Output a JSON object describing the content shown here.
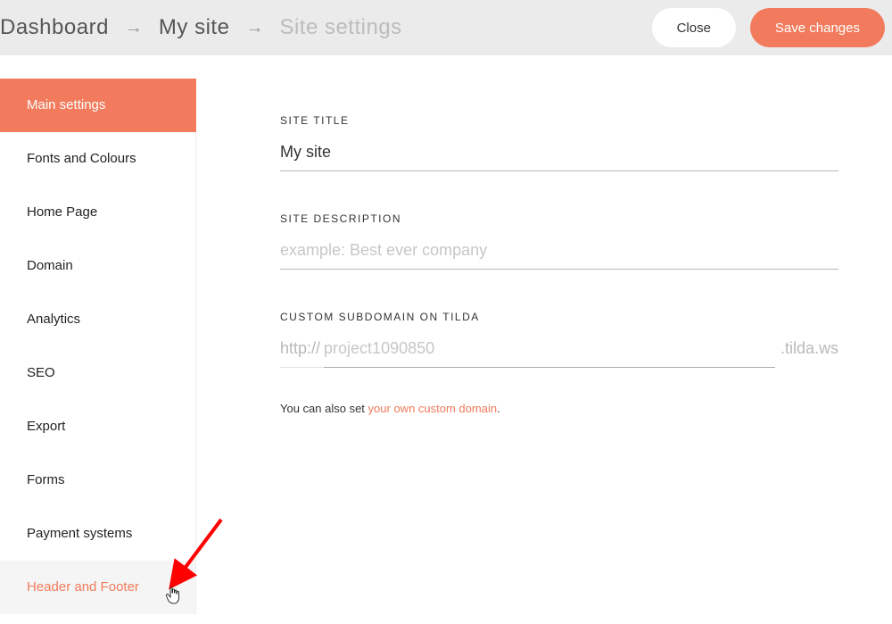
{
  "breadcrumb": {
    "dashboard": "Dashboard",
    "site_name": "My site",
    "current": "Site settings"
  },
  "buttons": {
    "close": "Close",
    "save": "Save changes"
  },
  "sidebar": {
    "items": [
      {
        "label": "Main settings",
        "state": "active"
      },
      {
        "label": "Fonts and Colours",
        "state": ""
      },
      {
        "label": "Home Page",
        "state": ""
      },
      {
        "label": "Domain",
        "state": ""
      },
      {
        "label": "Analytics",
        "state": ""
      },
      {
        "label": "SEO",
        "state": ""
      },
      {
        "label": "Export",
        "state": ""
      },
      {
        "label": "Forms",
        "state": ""
      },
      {
        "label": "Payment systems",
        "state": ""
      },
      {
        "label": "Header and Footer",
        "state": "hover"
      }
    ]
  },
  "form": {
    "site_title": {
      "label": "SITE TITLE",
      "value": "My site"
    },
    "site_description": {
      "label": "SITE DESCRIPTION",
      "value": "",
      "placeholder": "example: Best ever company"
    },
    "subdomain": {
      "label": "CUSTOM SUBDOMAIN ON TILDA",
      "prefix": "http://",
      "value": "",
      "placeholder": "project1090850",
      "suffix": ".tilda.ws"
    },
    "helper": {
      "lead": "You can also set ",
      "link": "your own custom domain",
      "tail": "."
    }
  },
  "colors": {
    "accent": "#f17b5c"
  }
}
